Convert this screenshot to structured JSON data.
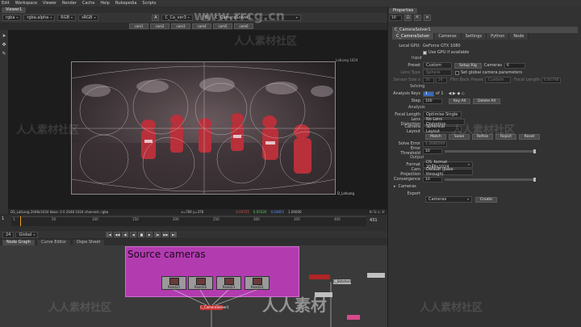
{
  "menu": [
    "Edit",
    "Workspace",
    "Viewer",
    "Render",
    "Cache",
    "Help",
    "Nukepedia",
    "Scripts"
  ],
  "viewer_tab": "Viewer1",
  "viewer_toolbar": {
    "channels": "rgba",
    "alpha": "rgba.alpha",
    "colorspace": "RGB",
    "input_a": "A",
    "node_a": "C_Ca_ver3",
    "input_b": "B",
    "node_b": "C_CameraSolver1"
  },
  "camera_buttons": [
    "cam1",
    "cam2",
    "cam3",
    "cam4",
    "cam5",
    "cam6"
  ],
  "viewer": {
    "frame_label_tr": "LatLong 1024",
    "frame_label_br": "D_LatLong",
    "info_left": "DS_LatLong 2048x1024  bbox: 0 0 2048 1024 channels: rgba",
    "info_center": "x=769 y=376",
    "info_values": [
      "0.04755",
      "0.05029",
      "0.04855",
      "1.00000"
    ],
    "info_right": "H: S: L: V:"
  },
  "timeline": {
    "ticks": [
      "1",
      "50",
      "100",
      "150",
      "200",
      "250",
      "300",
      "350",
      "400"
    ],
    "current_frame": "1",
    "end_frame": "431",
    "fps": "24",
    "mode": "Global"
  },
  "transport_labels": [
    "|◀",
    "◀◀",
    "◀|",
    "◀",
    "■",
    "▶",
    "|▶",
    "▶▶",
    "▶|"
  ],
  "node_graph": {
    "tabs": [
      "Node Graph",
      "Curve Editor",
      "Dope Sheet"
    ],
    "backdrop_title": "Source cameras",
    "reads": [
      "Read25",
      "Read26",
      "Read23",
      "Read24"
    ],
    "solver_label": "C_CameraSolver1",
    "stitch_label": "C_Stitcher1"
  },
  "properties": {
    "title": "Properties",
    "count": "10",
    "node_name": "C_CameraSolver1",
    "subtabs": [
      "C_CameraSolver",
      "Cameras",
      "Settings",
      "Python",
      "Node"
    ],
    "local_gpu_label": "Local GPU:",
    "local_gpu_value": "GeForce GTX 1080",
    "use_gpu_label": "Use GPU if available",
    "input_section": "Input",
    "preset_label": "Preset",
    "preset_value": "Custom",
    "setup_rig": "Setup Rig",
    "cameras_label": "Cameras",
    "cameras_value": "6",
    "lens_type_label": "Lens Type",
    "lens_type_value": "Sphere",
    "set_global": "Set global camera parameters",
    "sensor_size_label": "Sensor Size x",
    "sensor_size_value": "36",
    "sensor_size_y": "24",
    "film_back_label": "Film Back Preset",
    "film_back_value": "Custom",
    "focal_length_label": "Focal Length",
    "focal_length_value": "6.80798",
    "solving_section": "Solving",
    "analysis_keys_label": "Analysis Keys",
    "analysis_keys_value": "1",
    "analysis_keys_of": "of 1",
    "step_label": "Step",
    "step_value": "100",
    "key_all": "Key All",
    "delete_all": "Delete All",
    "analysis_section": "Analysis",
    "focal_length2_label": "Focal Length",
    "focal_length2_value": "Optimise Single",
    "lens_distortion_label": "Lens Distortion",
    "lens_distortion_value": "No Lens Distortion",
    "camera_layout_label": "Camera Layout",
    "camera_layout_value": "Spherical Layout",
    "action_buttons": [
      "Match",
      "Solve",
      "Refine",
      "Reject",
      "Reset"
    ],
    "solve_error_label": "Solve Error",
    "solve_error_value": "1.2046504",
    "error_threshold_label": "Error Threshold",
    "error_threshold_value": "10",
    "output_section": "Output",
    "format_label": "Format",
    "format_value": "DS_format 2048x1024",
    "cam_projection_label": "Cam Projection",
    "cam_projection_value": "Default (pass-through)",
    "convergence_label": "Convergence",
    "convergence_value": "10",
    "cameras_section": "Cameras",
    "export_label": "Export",
    "export_value": "Cameras",
    "create": "Create"
  },
  "watermark_text": "人人素材社区",
  "watermark_url": "www.rrcg.cn",
  "watermark_logo": "人人素材",
  "colors": {
    "backdrop": "#b23bb0",
    "accent_blue": "#3a6ab8",
    "playhead": "#f0a020"
  }
}
